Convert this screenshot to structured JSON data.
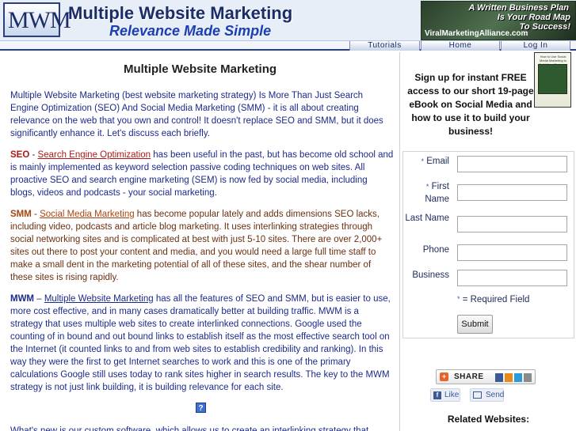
{
  "header": {
    "logo": "MWM",
    "site_title": "Multiple Website Marketing",
    "tagline": "Relevance Made Simple",
    "banner": {
      "line1": "A Written Business Plan",
      "line2": "Is Your Road Map",
      "line3": "To Success!",
      "url": "ViralMarketingAlliance.com"
    }
  },
  "nav": {
    "items": [
      "Tutorials",
      "Home",
      "Log In"
    ]
  },
  "main": {
    "title": "Multiple Website Marketing",
    "intro": "Multiple Website Marketing (best website marketing strategy) Is More Than Just Search Engine Optimization (SEO) And Social Media Marketing (SMM) - it is all about creating relevance on the web that you own and control! It doesn't replace SEO and SMM, but it does significantly enhance it. Let's discuss each briefly.",
    "seo": {
      "keyword": "SEO",
      "sep": " - ",
      "link": "Search Engine Optimization",
      "text": " has been useful in the past, but has become old school and is mainly implemented as keyword selection passive coding techniques on web sites. All proactive SEO and search engine marketing (SEM) is now fed by social media, including blogs, videos and podcasts - your social marketing."
    },
    "smm": {
      "keyword": "SMM",
      "sep": " - ",
      "link": "Social Media Marketing",
      "text": " has become popular lately and adds dimensions SEO lacks, including video, podcasts and article blog marketing. It uses interlinking strategies through social networking sites and is complicated at best with just 5-10 sites. There are over 2,000+ sites out there to post your content and media, and you would need a large full time staff to make a small dent in the marketing potential of all of these sites, and the shear number of these sites is rising rapidly."
    },
    "mwm": {
      "keyword": "MWM",
      "sep": " – ",
      "link": "Multiple Website Marketing",
      "text": " has all the features of SEO and SMM, but is easier to use, more cost effective, and in many cases dramatically better at building traffic. MWM is a strategy that uses multiple web sites to create interlinked connections. Google used the counting of in bound and out bound links to establish itself as the most effective search tool on the Internet (it counted links to and from web sites to establish credibility and ranking). In this way they were the first to get Internet searches to work and this is one of the primary calculations Google still uses today to rank sites higher in search results. The key to the MWM strategy is not just link building, it is building relevance for each site."
    },
    "help_icon": "?",
    "whats_new": "What's new is our custom software, which allows us to create an interlinking strategy that"
  },
  "sidebar": {
    "signup": "Sign up for instant FREE access to our short 19-page eBook on Social Media and how to use it to build your business!",
    "ebook_title": "How to Use Social Media Marketing to Build Your Business",
    "form": {
      "required_mark": "*",
      "email_label": "Email",
      "first_name_label": "First Name",
      "last_name_label": "Last Name",
      "phone_label": "Phone",
      "business_label": "Business",
      "required_note": "= Required Field",
      "submit_label": "Submit"
    },
    "share_label": "SHARE",
    "like_label": "Like",
    "send_label": "Send",
    "related_heading": "Related Websites:"
  }
}
